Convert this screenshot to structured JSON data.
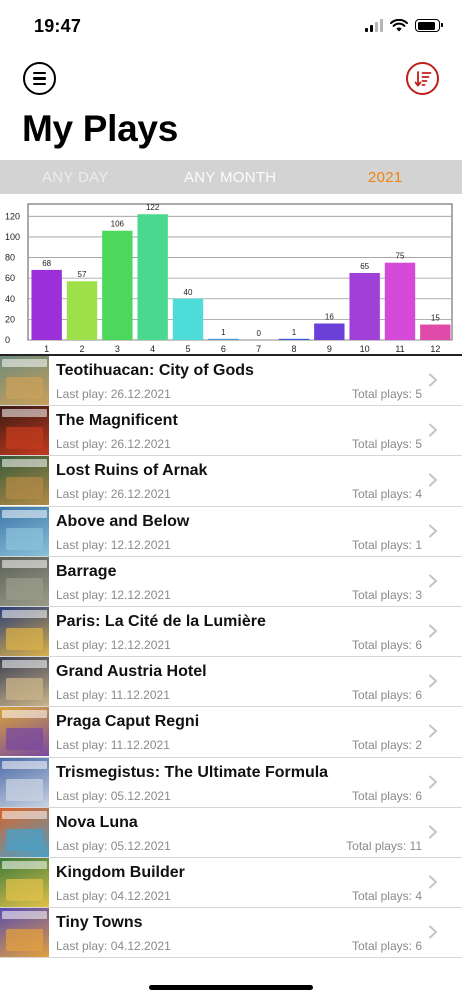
{
  "status_bar": {
    "time": "19:47"
  },
  "header": {
    "title": "My Plays"
  },
  "filters": {
    "day": "ANY DAY",
    "month": "ANY MONTH",
    "year": "2021",
    "selected": "2021"
  },
  "colors": {
    "accent": "#f0840e",
    "sort_button": "#c0201b",
    "filter_bar": "#d3d3d3"
  },
  "chart_data": {
    "type": "bar",
    "categories": [
      "1",
      "2",
      "3",
      "4",
      "5",
      "6",
      "7",
      "8",
      "9",
      "10",
      "11",
      "12"
    ],
    "values": [
      68,
      57,
      106,
      122,
      40,
      1,
      0,
      1,
      16,
      65,
      75,
      15
    ],
    "colors": [
      "#9b30d9",
      "#9ee04a",
      "#4cd85a",
      "#4ad98e",
      "#4ddcd8",
      "#4a9ad8",
      "#3a7ad8",
      "#3a5ad8",
      "#6a40d8",
      "#a040d8",
      "#d64ad8",
      "#e04aa8"
    ],
    "yticks": [
      0,
      20,
      40,
      60,
      80,
      100,
      120
    ],
    "ylim": [
      0,
      130
    ],
    "grid": true,
    "data_labels": true
  },
  "games": [
    {
      "title": "Teotihuacan: City of Gods",
      "last_play": "Last play: 26.12.2021",
      "total": "Total plays: 5"
    },
    {
      "title": "The Magnificent",
      "last_play": "Last play: 26.12.2021",
      "total": "Total plays: 5"
    },
    {
      "title": "Lost Ruins of Arnak",
      "last_play": "Last play: 26.12.2021",
      "total": "Total plays: 4"
    },
    {
      "title": "Above and Below",
      "last_play": "Last play: 12.12.2021",
      "total": "Total plays: 1"
    },
    {
      "title": "Barrage",
      "last_play": "Last play: 12.12.2021",
      "total": "Total plays: 3"
    },
    {
      "title": "Paris: La Cité de la Lumière",
      "last_play": "Last play: 12.12.2021",
      "total": "Total plays: 6"
    },
    {
      "title": "Grand Austria Hotel",
      "last_play": "Last play: 11.12.2021",
      "total": "Total plays: 6"
    },
    {
      "title": "Praga Caput Regni",
      "last_play": "Last play: 11.12.2021",
      "total": "Total plays: 2"
    },
    {
      "title": "Trismegistus: The Ultimate Formula",
      "last_play": "Last play: 05.12.2021",
      "total": "Total plays: 6"
    },
    {
      "title": "Nova Luna",
      "last_play": "Last play: 05.12.2021",
      "total": "Total plays: 11"
    },
    {
      "title": "Kingdom Builder",
      "last_play": "Last play: 04.12.2021",
      "total": "Total plays: 4"
    },
    {
      "title": "Tiny Towns",
      "last_play": "Last play: 04.12.2021",
      "total": "Total plays: 6"
    }
  ],
  "thumb_colors": [
    [
      "#6d8a7a",
      "#c9a05a"
    ],
    [
      "#3a1a14",
      "#c23b1e"
    ],
    [
      "#355a3a",
      "#b28a46"
    ],
    [
      "#3b76a8",
      "#8bc0d8"
    ],
    [
      "#5b5f55",
      "#9a9c8a"
    ],
    [
      "#2a3f7a",
      "#d9b04a"
    ],
    [
      "#3a3e52",
      "#c9b48a"
    ],
    [
      "#d9a23a",
      "#7a4aa0"
    ],
    [
      "#4a6aa8",
      "#c8d2e0"
    ],
    [
      "#d8642a",
      "#4aa0c8"
    ],
    [
      "#3a7a3a",
      "#e0c04a"
    ],
    [
      "#5a4ab0",
      "#e0a040"
    ]
  ]
}
